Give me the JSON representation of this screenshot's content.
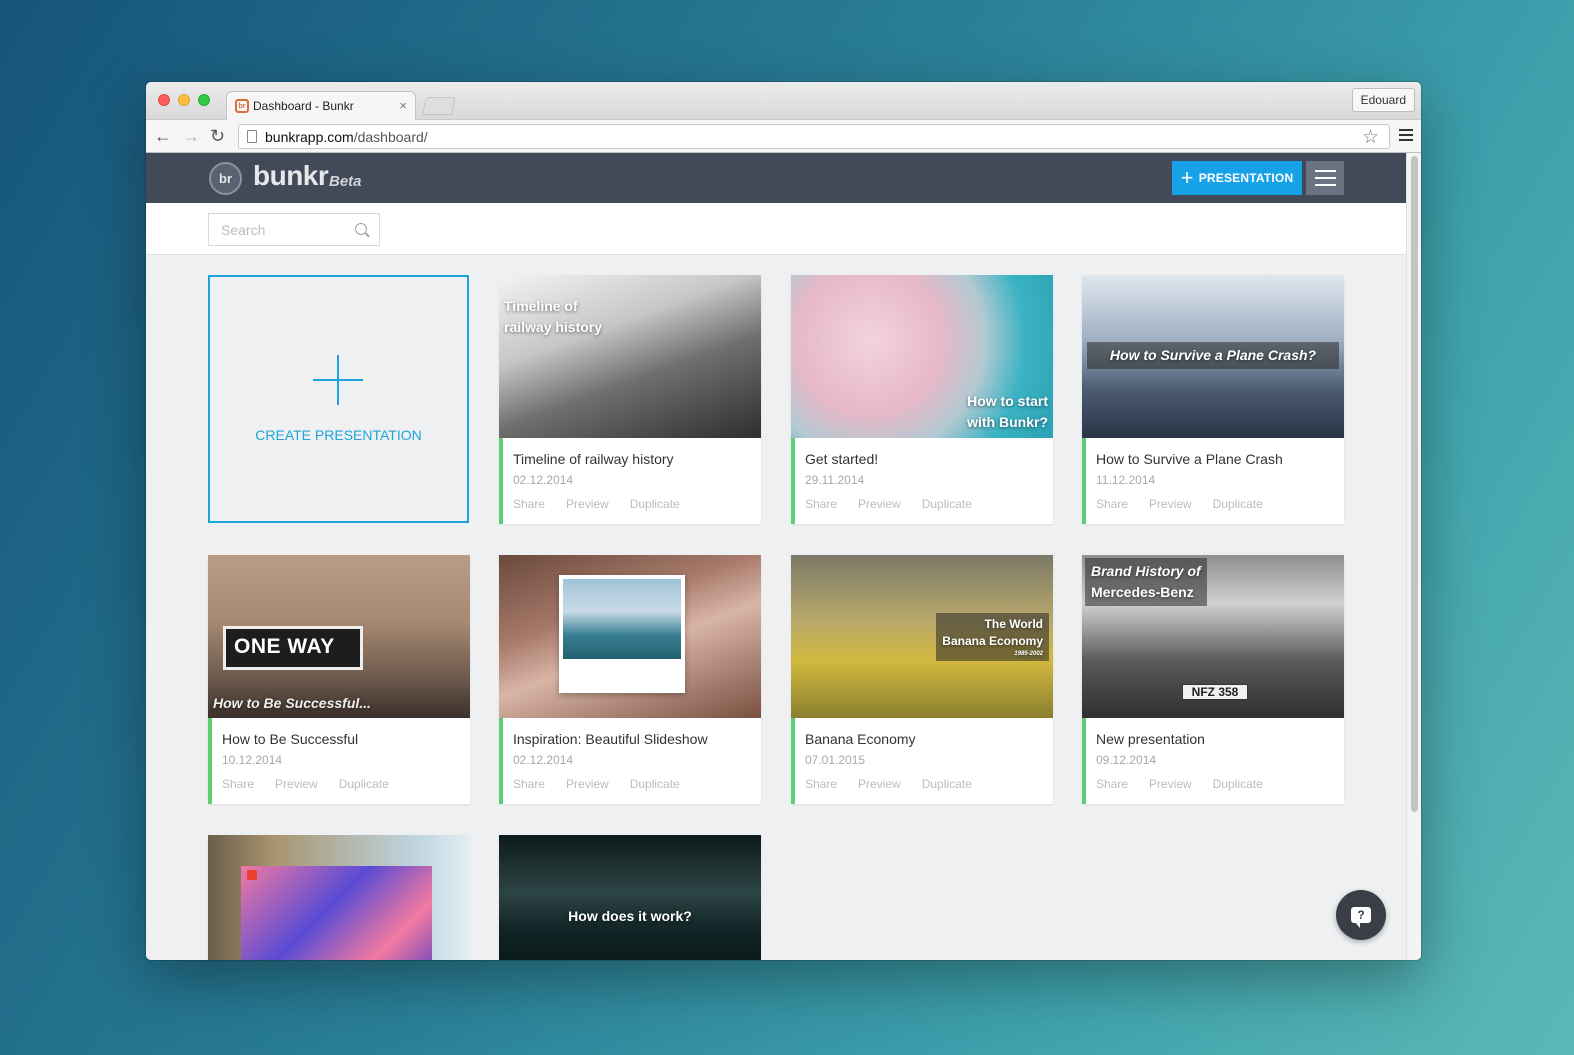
{
  "browser": {
    "tab_title": "Dashboard - Bunkr",
    "tab_favicon": "br",
    "tab_close": "×",
    "profile_name": "Edouard",
    "url_domain": "bunkrapp.com",
    "url_path": "/dashboard/",
    "back_icon": "←",
    "forward_icon": "→",
    "reload_icon": "↻",
    "star_icon": "☆"
  },
  "app": {
    "logo_mark": "br",
    "logo_text": "bunkr",
    "logo_badge": "Beta",
    "new_presentation_label": "PRESENTATION",
    "plus_icon": "+",
    "accent_color": "#17a2e8",
    "header_color": "#424a5a",
    "card_accent_color": "#5fce72"
  },
  "search": {
    "placeholder": "Search"
  },
  "create_card": {
    "label": "CREATE PRESENTATION"
  },
  "card_actions": {
    "share": "Share",
    "preview": "Preview",
    "duplicate": "Duplicate"
  },
  "cards": [
    {
      "title": "Timeline of railway history",
      "date": "02.12.2014",
      "thumb_line1": "Timeline of",
      "thumb_line2": "railway history"
    },
    {
      "title": "Get started!",
      "date": "29.11.2014",
      "thumb_line1": "How to start",
      "thumb_line2": "with Bunkr?"
    },
    {
      "title": "How to Survive a Plane Crash",
      "date": "11.12.2014",
      "thumb_line1": "How to Survive a Plane Crash?"
    },
    {
      "title": "How to Be Successful",
      "date": "10.12.2014",
      "thumb_line1": "How to Be Successful...",
      "sign_text": "ONE WAY"
    },
    {
      "title": "Inspiration: Beautiful Slideshow",
      "date": "02.12.2014"
    },
    {
      "title": "Banana Economy",
      "date": "07.01.2015",
      "thumb_line1": "The World",
      "thumb_line2": "Banana Economy",
      "thumb_line3": "1985-2002"
    },
    {
      "title": "New presentation",
      "date": "09.12.2014",
      "thumb_line1": "Brand History of",
      "thumb_line2": "Mercedes-Benz",
      "plate": "NFZ 358"
    },
    {
      "title": "",
      "date": ""
    },
    {
      "title": "",
      "date": "",
      "thumb_line1": "How does it work?"
    }
  ],
  "help": {
    "icon": "?"
  }
}
